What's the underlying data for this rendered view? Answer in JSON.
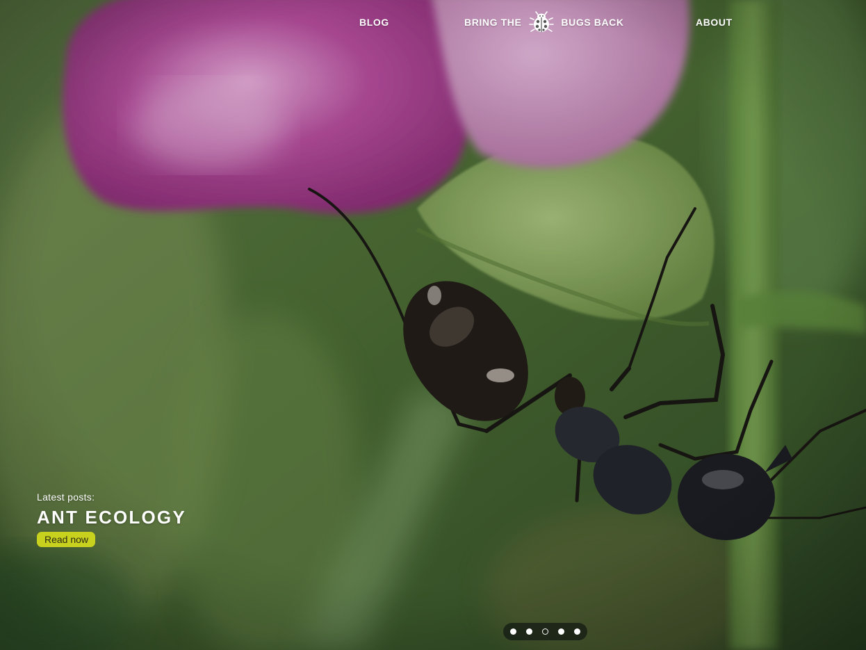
{
  "nav": {
    "blog_label": "BLOG",
    "brand_left": "BRING THE",
    "brand_right": "BUGS BACK",
    "about_label": "ABOUT"
  },
  "hero": {
    "kicker": "Latest posts:",
    "title": "ANT ECOLOGY",
    "cta_label": "Read now",
    "cta_color": "#c9d11f"
  },
  "carousel": {
    "slide_count": 5,
    "active_index": 2
  },
  "icons": {
    "brand_logo": "ladybug-icon"
  }
}
